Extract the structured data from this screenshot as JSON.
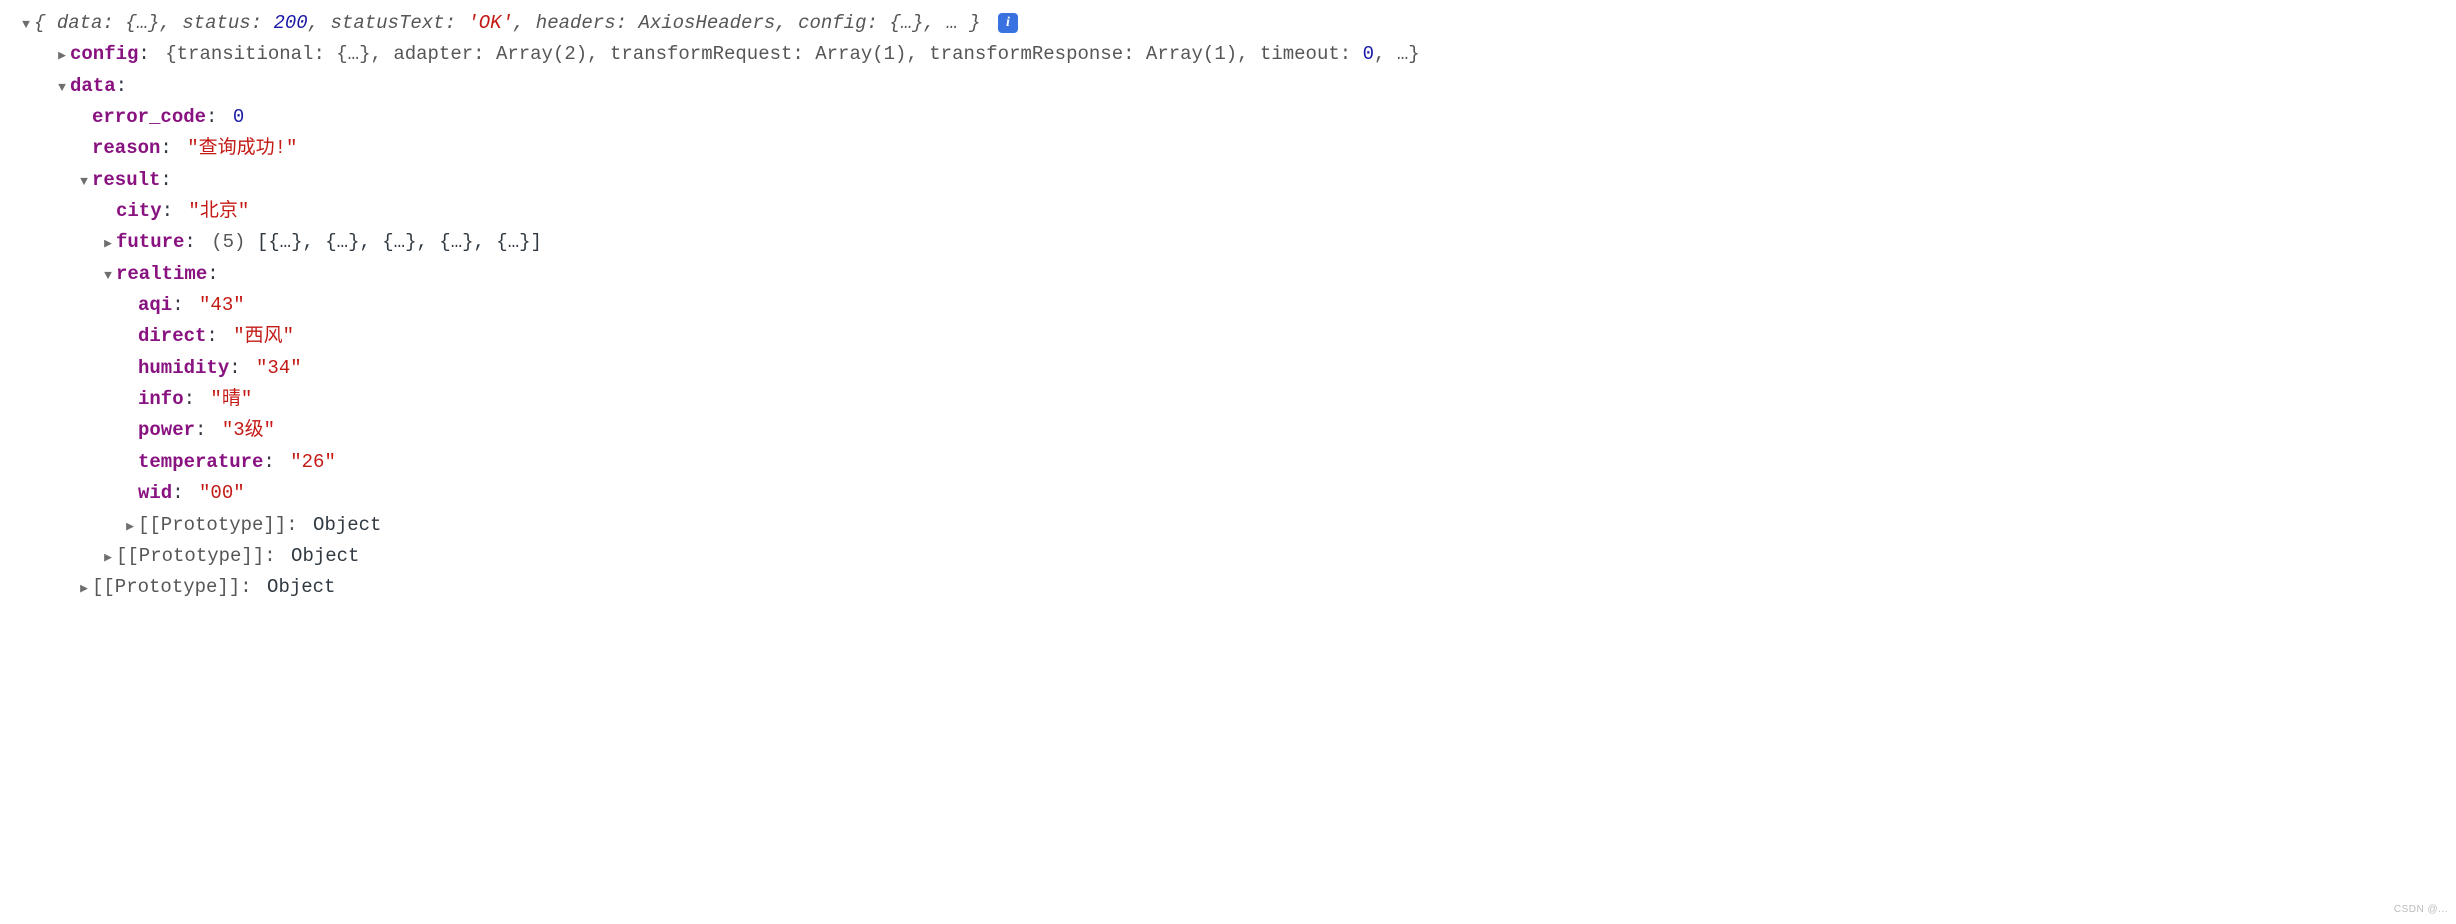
{
  "root": {
    "summary_prefix": "{",
    "summary_suffix": "}",
    "parts": [
      {
        "k": "data",
        "v": "{…}"
      },
      {
        "k": "status",
        "v": "200",
        "numClass": true
      },
      {
        "k": "statusText",
        "v": "'OK'",
        "strClass": true
      },
      {
        "k": "headers",
        "v": "AxiosHeaders"
      },
      {
        "k": "config",
        "v": "{…}"
      },
      {
        "k": "…",
        "keyOnly": true
      }
    ]
  },
  "config": {
    "label": "config",
    "summary_prefix": "{",
    "summary_suffix": "}",
    "parts": [
      {
        "k": "transitional",
        "v": "{…}"
      },
      {
        "k": "adapter",
        "v": "Array(2)"
      },
      {
        "k": "transformRequest",
        "v": "Array(1)"
      },
      {
        "k": "transformResponse",
        "v": "Array(1)"
      },
      {
        "k": "timeout",
        "v": "0",
        "numClass": true
      },
      {
        "k": "…",
        "keyOnly": true
      }
    ]
  },
  "data": {
    "label": "data",
    "error_code": {
      "k": "error_code",
      "v": "0"
    },
    "reason": {
      "k": "reason",
      "v": "\"查询成功!\""
    },
    "result": {
      "label": "result",
      "city": {
        "k": "city",
        "v": "\"北京\""
      },
      "future": {
        "k": "future",
        "count": "(5)",
        "preview": "[{…}, {…}, {…}, {…}, {…}]"
      },
      "realtime": {
        "label": "realtime",
        "aqi": {
          "k": "aqi",
          "v": "\"43\""
        },
        "direct": {
          "k": "direct",
          "v": "\"西风\""
        },
        "humidity": {
          "k": "humidity",
          "v": "\"34\""
        },
        "info": {
          "k": "info",
          "v": "\"晴\""
        },
        "power": {
          "k": "power",
          "v": "\"3级\""
        },
        "temperature": {
          "k": "temperature",
          "v": "\"26\""
        },
        "wid": {
          "k": "wid",
          "v": "\"00\""
        }
      }
    }
  },
  "proto": {
    "label": "[[Prototype]]",
    "value": "Object"
  },
  "info_icon": "i",
  "watermark": "CSDN @..."
}
